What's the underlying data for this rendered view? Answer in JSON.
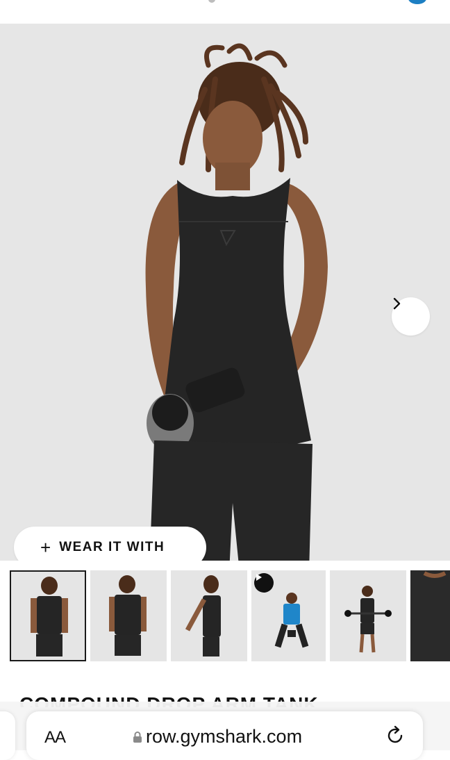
{
  "hero": {
    "wear_button": {
      "plus": "+",
      "label": "WEAR IT WITH"
    },
    "next_icon": "chevron-right-icon"
  },
  "gallery": {
    "thumbnails": [
      {
        "name": "thumb-front",
        "selected": true
      },
      {
        "name": "thumb-back",
        "selected": false
      },
      {
        "name": "thumb-side",
        "selected": false
      },
      {
        "name": "thumb-video",
        "selected": false,
        "icon": "play-icon"
      },
      {
        "name": "thumb-curl",
        "selected": false
      },
      {
        "name": "thumb-detail",
        "selected": false
      }
    ]
  },
  "product": {
    "title": "COMPOUND DROP ARM TANK"
  },
  "browser": {
    "text_size_label": "AA",
    "url": "row.gymshark.com",
    "lock_icon": "lock-icon",
    "reload_icon": "reload-icon"
  },
  "colors": {
    "hero_bg": "#e6e6e6",
    "garment": "#252525",
    "skin": "#8a5a3c",
    "text": "#111111"
  }
}
